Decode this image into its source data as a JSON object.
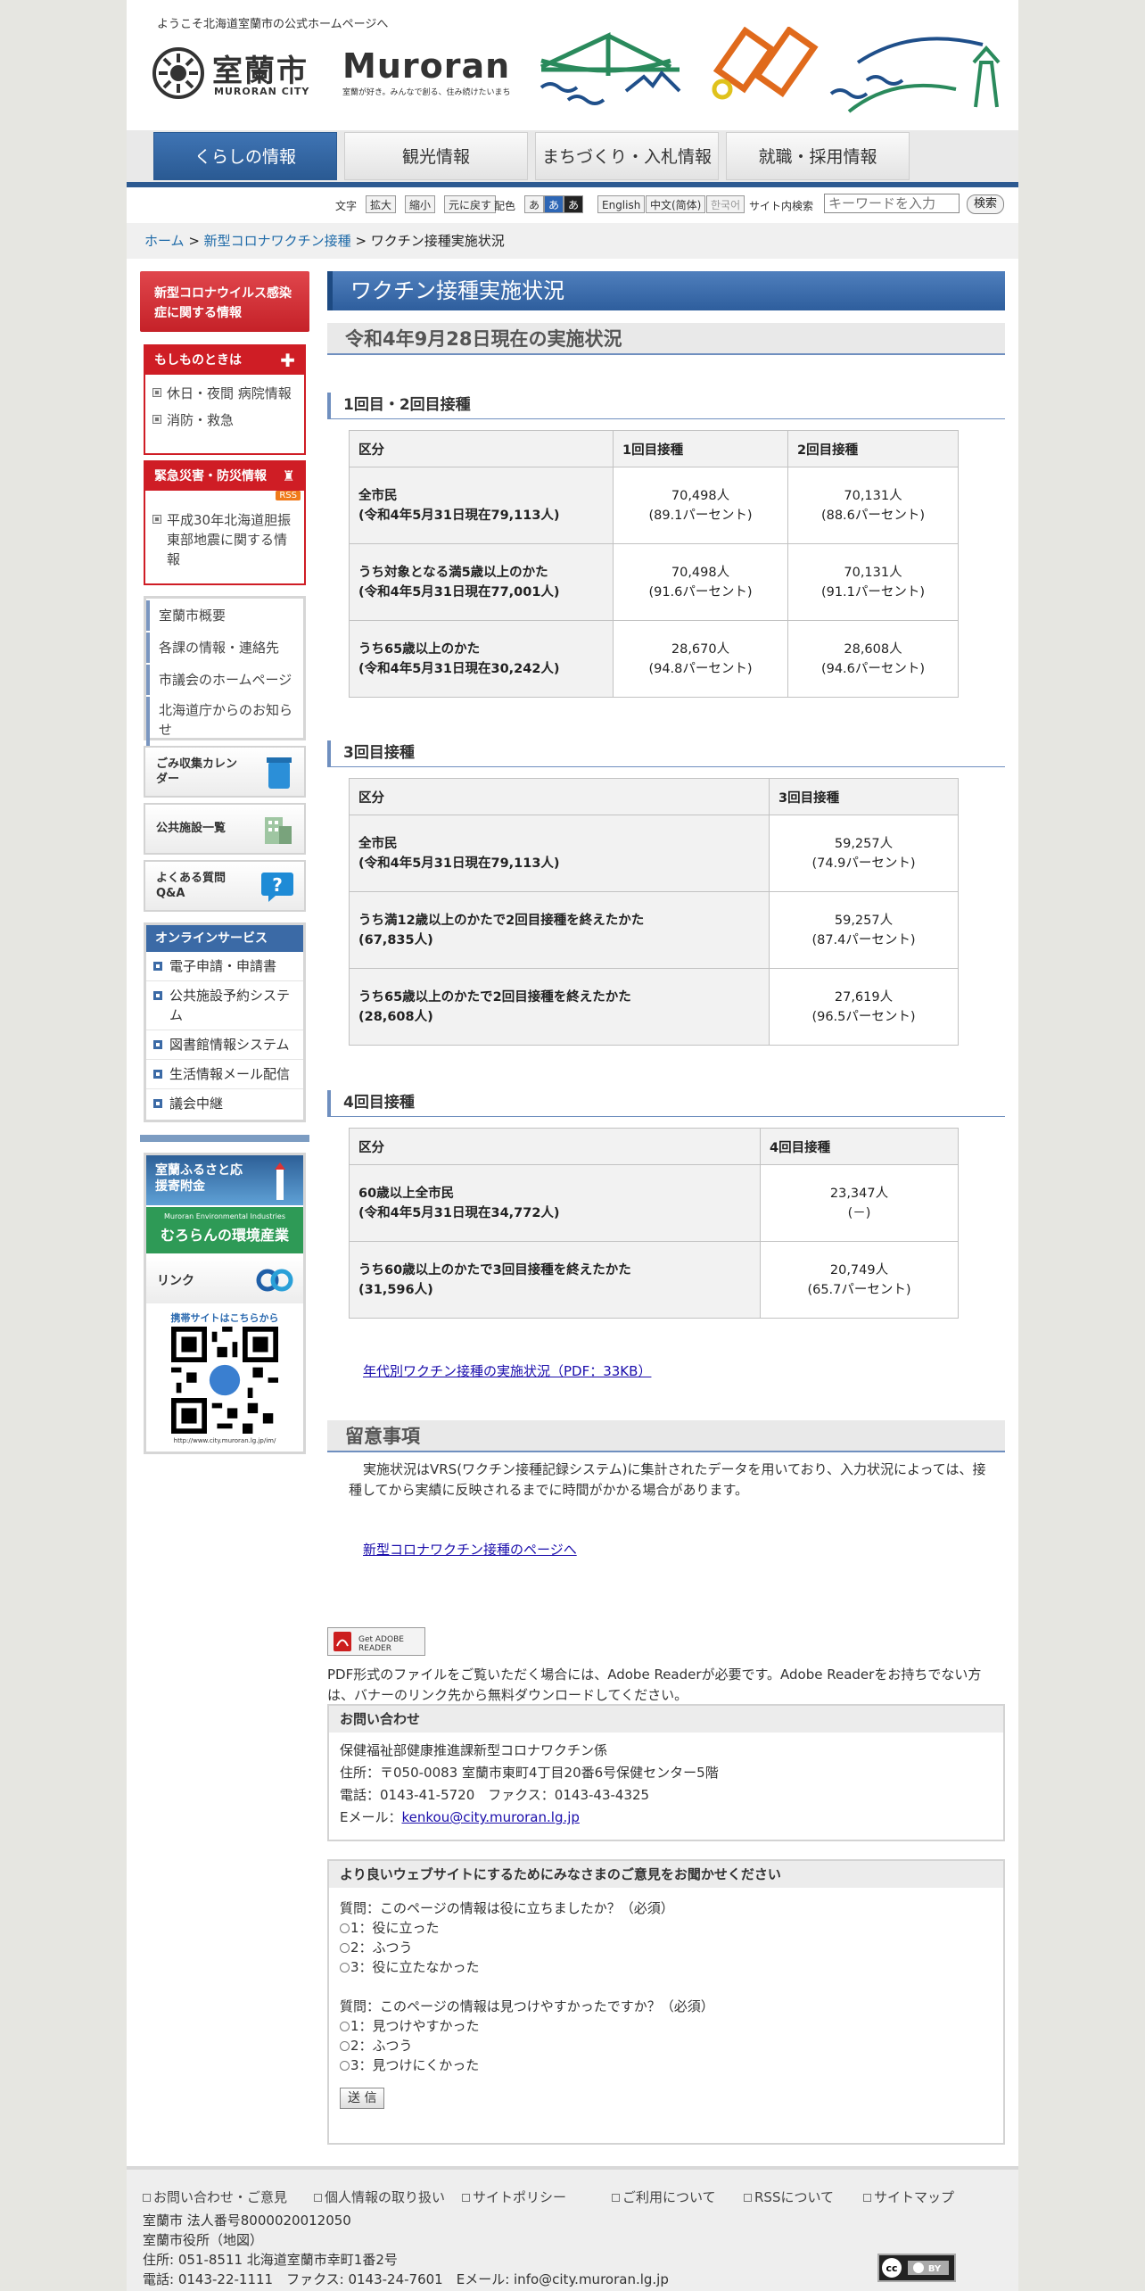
{
  "header": {
    "welcome": "ようこそ北海道室蘭市の公式ホームページへ",
    "city_name_jp": "室蘭市",
    "city_name_en": "MURORAN CITY",
    "brand_word": "Muroran",
    "brand_tagline": "室蘭が好き。みんなで創る、住み続けたいまち"
  },
  "gnav": [
    "くらしの情報",
    "観光情報",
    "まちづくり・入札情報",
    "就職・採用情報"
  ],
  "tools": {
    "moji_label": "文字",
    "moji_buttons": [
      "拡大",
      "縮小",
      "元に戻す"
    ],
    "color_label": "配色",
    "color_buttons": [
      "あ",
      "あ",
      "あ"
    ],
    "languages": [
      "English",
      "中文(简体)",
      "한국어"
    ],
    "search_label": "サイト内検索",
    "search_placeholder": "キーワードを入力",
    "search_button": "検索"
  },
  "breadcrumb": {
    "home": "ホーム",
    "sep": " > ",
    "parent": "新型コロナワクチン接種",
    "current": "ワクチン接種実施状況"
  },
  "sidebar": {
    "covid_link": "新型コロナウイルス感染症に関する情報",
    "emergency_title": "もしものときは",
    "emergency_items": [
      "休日・夜間 病院情報",
      "消防・救急"
    ],
    "disaster_title": "緊急災害・防災情報",
    "rss": "RSS",
    "disaster_items": [
      "平成30年北海道胆振東部地震に関する情報"
    ],
    "links": [
      "室蘭市概要",
      "各課の情報・連絡先",
      "市議会のホームページ",
      "北海道庁からのお知らせ"
    ],
    "banners": [
      "ごみ収集カレンダー",
      "公共施設一覧",
      "よくある質問Q&A"
    ],
    "online_title": "オンラインサービス",
    "online_items": [
      "電子申請・申請書",
      "公共施設予約システム",
      "図書館情報システム",
      "生活情報メール配信",
      "議会中継"
    ],
    "furusato": "室蘭ふるさと応援寄附金",
    "env_en": "Muroran Environmental Industries",
    "env_jp": "むろらんの環境産業",
    "link_label": "リンク",
    "mobile_text": "携帯サイトはこちらから",
    "mobile_url": "http://www.city.muroran.lg.jp/im/"
  },
  "main": {
    "title": "ワクチン接種実施状況",
    "date_heading": "令和4年9月28日現在の実施状況",
    "sec1": {
      "heading": "1回目・2回目接種",
      "cols": [
        "区分",
        "1回目接種",
        "2回目接種"
      ],
      "rows": [
        {
          "k1": "全市民",
          "k2": "(令和4年5月31日現在79,113人)",
          "a1": "70,498人",
          "a2": "(89.1パーセント)",
          "b1": "70,131人",
          "b2": "(88.6パーセント)"
        },
        {
          "k1": "うち対象となる満5歳以上のかた",
          "k2": "(令和4年5月31日現在77,001人)",
          "a1": "70,498人",
          "a2": "(91.6パーセント)",
          "b1": "70,131人",
          "b2": "(91.1パーセント)"
        },
        {
          "k1": "うち65歳以上のかた",
          "k2": "(令和4年5月31日現在30,242人)",
          "a1": "28,670人",
          "a2": "(94.8パーセント)",
          "b1": "28,608人",
          "b2": "(94.6パーセント)"
        }
      ]
    },
    "sec2": {
      "heading": "3回目接種",
      "cols": [
        "区分",
        "3回目接種"
      ],
      "rows": [
        {
          "k1": "全市民",
          "k2": "(令和4年5月31日現在79,113人)",
          "a1": "59,257人",
          "a2": "(74.9パーセント)"
        },
        {
          "k1": "うち満12歳以上のかたで2回目接種を終えたかた",
          "k2": "(67,835人)",
          "a1": "59,257人",
          "a2": "(87.4パーセント)"
        },
        {
          "k1": "うち65歳以上のかたで2回目接種を終えたかた",
          "k2": "(28,608人)",
          "a1": "27,619人",
          "a2": "(96.5パーセント)"
        }
      ]
    },
    "sec3": {
      "heading": "4回目接種",
      "cols": [
        "区分",
        "4回目接種"
      ],
      "rows": [
        {
          "k1": "60歳以上全市民",
          "k2": "(令和4年5月31日現在34,772人)",
          "a1": "23,347人",
          "a2": "(－)"
        },
        {
          "k1": "うち60歳以上のかたで3回目接種を終えたかた",
          "k2": "(31,596人)",
          "a1": "20,749人",
          "a2": "(65.7パーセント)"
        }
      ]
    },
    "pdf_link": "年代別ワクチン接種の実施状況（PDF：33KB）",
    "notes_heading": "留意事項",
    "notes_text": "実施状況はVRS(ワクチン接種記録システム)に集計されたデータを用いており、入力状況によっては、接種してから実績に反映されるまでに時間がかかる場合があります。",
    "covid_page_link": "新型コロナワクチン接種のページへ",
    "adobe_text": "PDF形式のファイルをご覧いただく場合には、Adobe Readerが必要です。Adobe Readerをお持ちでない方は、バナーのリンク先から無料ダウンロードしてください。",
    "contact": {
      "title": "お問い合わせ",
      "dept": "保健福祉部健康推進課新型コロナワクチン係",
      "address": "住所：〒050-0083 室蘭市東町4丁目20番6号保健センター5階",
      "phone": "電話：0143-41-5720　ファクス：0143-43-4325",
      "email_label": "Eメール：",
      "email": "kenkou@city.muroran.lg.jp"
    },
    "survey": {
      "title": "より良いウェブサイトにするためにみなさまのご意見をお聞かせください",
      "q1": "質問：このページの情報は役に立ちましたか？（必須）",
      "q1_opts": [
        "1：役に立った",
        "2：ふつう",
        "3：役に立たなかった"
      ],
      "q2": "質問：このページの情報は見つけやすかったですか？（必須）",
      "q2_opts": [
        "1：見つけやすかった",
        "2：ふつう",
        "3：見つけにくかった"
      ],
      "submit": "送 信"
    }
  },
  "footer": {
    "links": [
      "お問い合わせ・ご意見",
      "個人情報の取り扱い",
      "サイトポリシー",
      "ご利用について",
      "RSSについて",
      "サイトマップ"
    ],
    "corp": "室蘭市 法人番号8000020012050",
    "office": "室蘭市役所（地図）",
    "address": "住所: 051-8511 北海道室蘭市幸町1番2号",
    "phone": "電話: 0143-22-1111　ファクス: 0143-24-7601　Eメール: info@city.muroran.lg.jp"
  }
}
